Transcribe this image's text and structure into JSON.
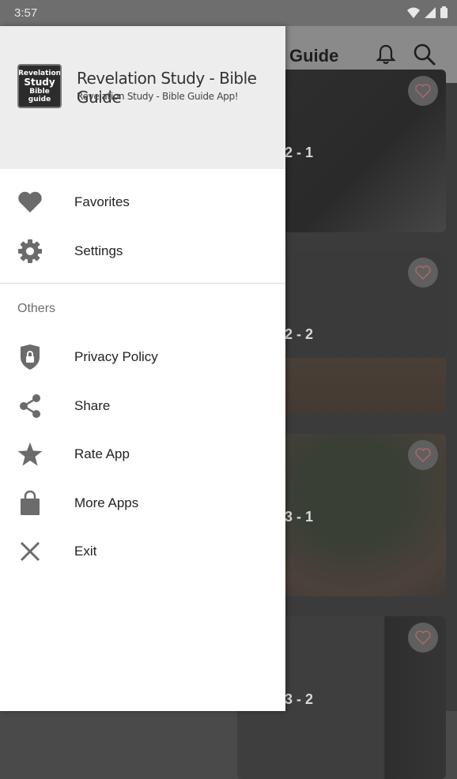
{
  "status_bar": {
    "time": "3:57"
  },
  "app_bar": {
    "title": "Guide"
  },
  "cards": [
    {
      "label": "2 - 1"
    },
    {
      "label": "2 - 2"
    },
    {
      "label": "3 - 1"
    },
    {
      "label": "3 - 2"
    }
  ],
  "drawer": {
    "header": {
      "title": "Revelation Study - Bible Guide",
      "subtitle": "Revelation Study - Bible Guide App!",
      "logo_lines": [
        "Revelation",
        "Study",
        "Bible guide"
      ]
    },
    "items": [
      {
        "label": "Favorites",
        "icon": "heart-icon"
      },
      {
        "label": "Settings",
        "icon": "gear-icon"
      }
    ],
    "section_title": "Others",
    "others": [
      {
        "label": "Privacy Policy",
        "icon": "shield-lock-icon"
      },
      {
        "label": "Share",
        "icon": "share-icon"
      },
      {
        "label": "Rate App",
        "icon": "star-icon"
      },
      {
        "label": "More Apps",
        "icon": "shopping-bag-icon"
      },
      {
        "label": "Exit",
        "icon": "close-icon"
      }
    ]
  }
}
